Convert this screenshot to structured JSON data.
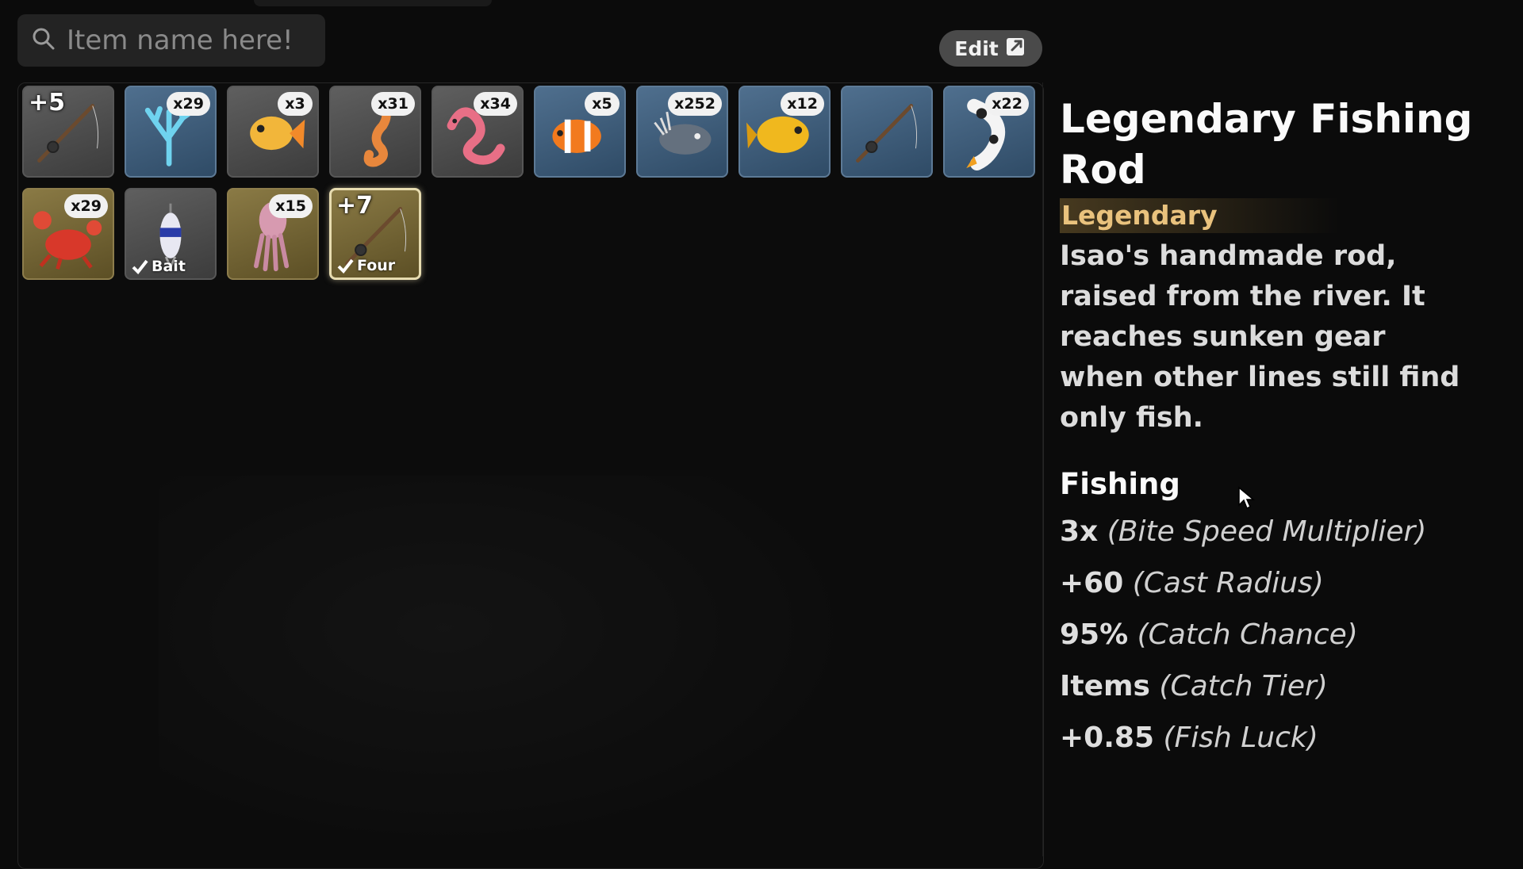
{
  "search": {
    "placeholder": "Item name here!"
  },
  "toolbar": {
    "edit_label": "Edit"
  },
  "inventory": [
    {
      "name": "rod-icon",
      "plus": "+5",
      "rarity": "common"
    },
    {
      "name": "coral-icon",
      "count": "x29",
      "rarity": "blue"
    },
    {
      "name": "goldfish-icon",
      "count": "x3",
      "rarity": "common"
    },
    {
      "name": "seahorse-icon",
      "count": "x31",
      "rarity": "common"
    },
    {
      "name": "worm-icon",
      "count": "x34",
      "rarity": "common"
    },
    {
      "name": "clownfish-icon",
      "count": "x5",
      "rarity": "blue"
    },
    {
      "name": "fish-skull-icon",
      "count": "x252",
      "rarity": "blue"
    },
    {
      "name": "yellow-fish-icon",
      "count": "x12",
      "rarity": "blue"
    },
    {
      "name": "rod-icon",
      "rarity": "blue"
    },
    {
      "name": "koi-icon",
      "count": "x22",
      "rarity": "blue"
    },
    {
      "name": "crab-icon",
      "count": "x29",
      "rarity": "gold"
    },
    {
      "name": "lure-icon",
      "equipped": "Bait",
      "rarity": "common"
    },
    {
      "name": "squid-icon",
      "count": "x15",
      "rarity": "gold"
    },
    {
      "name": "rod-icon",
      "plus": "+7",
      "equipped": "Four",
      "rarity": "gold",
      "selected": true
    }
  ],
  "details": {
    "title": "Legendary Fishing Rod",
    "rarity": "Legendary",
    "description": "Isao's handmade rod, raised from the river. It reaches sunken gear when other lines still find only fish.",
    "section": "Fishing",
    "stats": [
      {
        "value": "3x",
        "label": "(Bite Speed Multiplier)"
      },
      {
        "value": "+60",
        "label": "(Cast Radius)"
      },
      {
        "value": "95%",
        "label": "(Catch Chance)"
      },
      {
        "value": "Items",
        "label": "(Catch Tier)"
      },
      {
        "value": "+0.85",
        "label": "(Fish Luck)"
      }
    ]
  },
  "colors": {
    "rarity_legendary": "#e9c27d",
    "slot_blue": "#3f5f7e",
    "slot_gold": "#74663a"
  }
}
